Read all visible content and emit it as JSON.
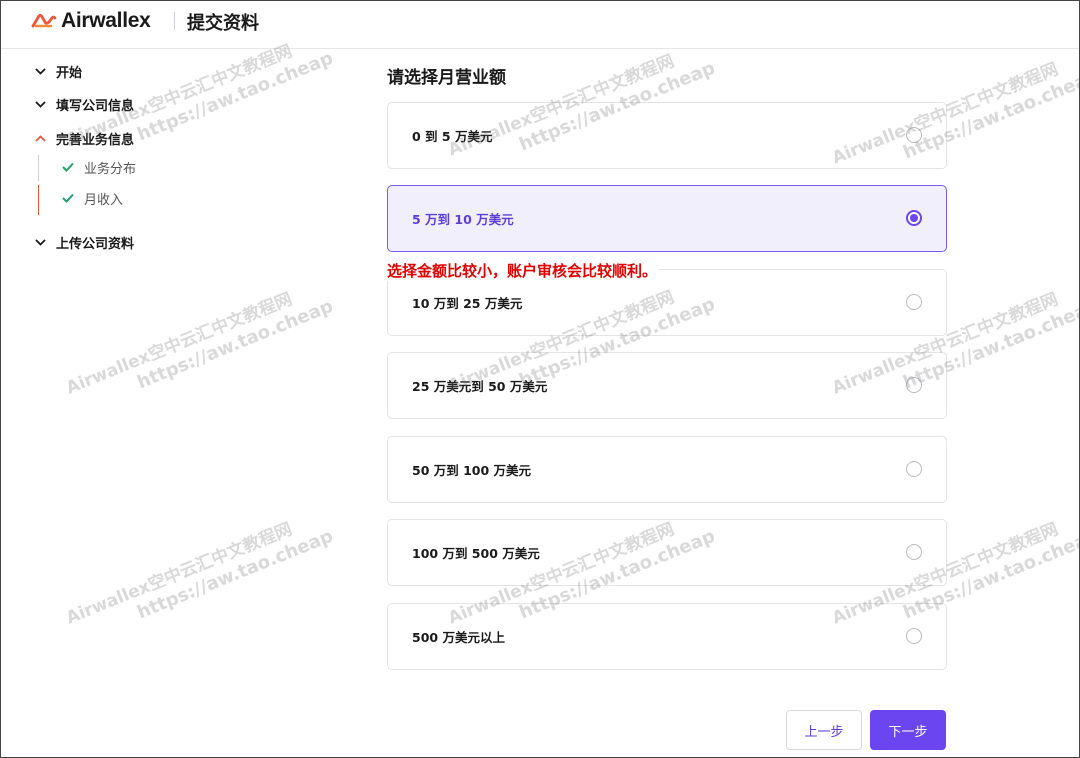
{
  "header": {
    "brand": "Airwallex",
    "title": "提交资料",
    "brand_color": "#e8583a"
  },
  "sidebar": {
    "steps": [
      {
        "label": "开始",
        "state": "collapsed"
      },
      {
        "label": "填写公司信息",
        "state": "collapsed"
      },
      {
        "label": "完善业务信息",
        "state": "expanded"
      },
      {
        "label": "上传公司资料",
        "state": "collapsed"
      }
    ],
    "substeps": [
      {
        "label": "业务分布",
        "done": true
      },
      {
        "label": "月收入",
        "done": true
      }
    ]
  },
  "main": {
    "title": "请选择月营业额",
    "options": [
      {
        "label": "0 到 5 万美元",
        "selected": false
      },
      {
        "label": "5 万到 10 万美元",
        "selected": true
      },
      {
        "label": "10 万到 25 万美元",
        "selected": false
      },
      {
        "label": "25 万美元到 50 万美元",
        "selected": false
      },
      {
        "label": "50 万到 100 万美元",
        "selected": false
      },
      {
        "label": "100 万到 500 万美元",
        "selected": false
      },
      {
        "label": "500 万美元以上",
        "selected": false
      }
    ],
    "annotation": "选择金额比较小，账户审核会比较顺利。"
  },
  "buttons": {
    "prev": "上一步",
    "next": "下一步"
  },
  "watermark": {
    "line1": "Airwallex空中云汇中文教程网",
    "line2": "https://aw.tao.cheap"
  },
  "colors": {
    "accent": "#6a45f0",
    "selected_bg": "#f1effc",
    "check": "#1fa36a",
    "annotation": "#e00000"
  }
}
